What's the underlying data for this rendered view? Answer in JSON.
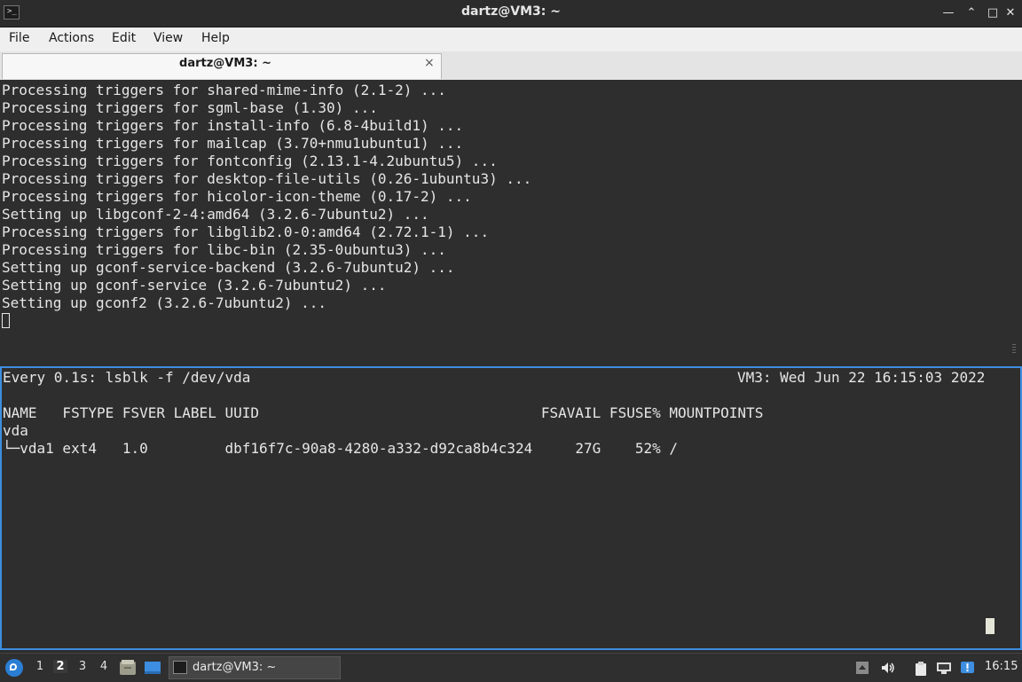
{
  "window": {
    "title": "dartz@VM3: ~",
    "controls": {
      "minimize": "—",
      "restore": "⌃",
      "maximize": "□",
      "close": "✕"
    }
  },
  "menubar": {
    "items": [
      "File",
      "Actions",
      "Edit",
      "View",
      "Help"
    ]
  },
  "tabs": [
    {
      "label": "dartz@VM3: ~",
      "close": "×"
    }
  ],
  "terminal_top": {
    "lines": [
      "Processing triggers for shared-mime-info (2.1-2) ...",
      "Processing triggers for sgml-base (1.30) ...",
      "Processing triggers for install-info (6.8-4build1) ...",
      "Processing triggers for mailcap (3.70+nmu1ubuntu1) ...",
      "Processing triggers for fontconfig (2.13.1-4.2ubuntu5) ...",
      "Processing triggers for desktop-file-utils (0.26-1ubuntu3) ...",
      "Processing triggers for hicolor-icon-theme (0.17-2) ...",
      "Setting up libgconf-2-4:amd64 (3.2.6-7ubuntu2) ...",
      "Processing triggers for libglib2.0-0:amd64 (2.72.1-1) ...",
      "Processing triggers for libc-bin (2.35-0ubuntu3) ...",
      "Setting up gconf-service-backend (3.2.6-7ubuntu2) ...",
      "Setting up gconf-service (3.2.6-7ubuntu2) ...",
      "Setting up gconf2 (3.2.6-7ubuntu2) ..."
    ]
  },
  "terminal_bottom": {
    "watch_header_left": "Every 0.1s: lsblk -f /dev/vda",
    "watch_header_right": "VM3: Wed Jun 22 16:15:03 2022",
    "lines": [
      "NAME   FSTYPE FSVER LABEL UUID                                 FSAVAIL FSUSE% MOUNTPOINTS",
      "vda",
      "└─vda1 ext4   1.0         dbf16f7c-90a8-4280-a332-d92ca8b4c324     27G    52% /"
    ]
  },
  "taskbar": {
    "workspaces": [
      "1",
      "2",
      "3",
      "4"
    ],
    "active_workspace": "2",
    "task_label": "dartz@VM3: ~",
    "clock": "16:15"
  },
  "colors": {
    "terminal_bg": "#2e2e2e",
    "terminal_fg": "#e6e6e6",
    "active_pane_border": "#3d8ee0",
    "menubar_bg": "#efefef"
  }
}
